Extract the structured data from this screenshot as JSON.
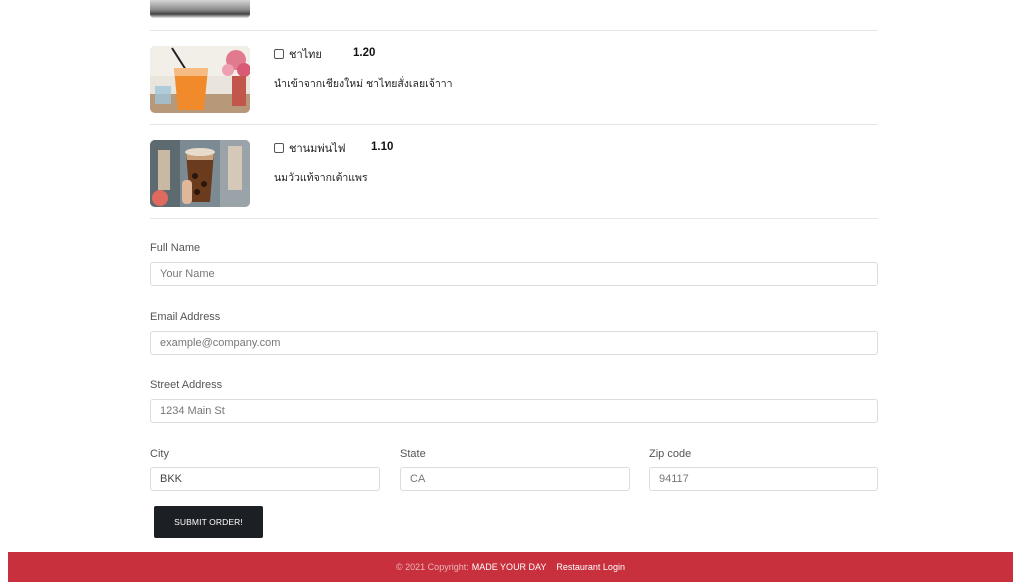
{
  "menu": {
    "items": [
      {
        "name": "ชาไทย",
        "price": "1.20",
        "description": "นำเข้าจากเชียงใหม่ ชาไทยสั่งเลยเจ้าาา",
        "image_icon": "thai-tea-photo"
      },
      {
        "name": "ชานมพ่นไฟ",
        "price": "1.10",
        "description": "นมวัวแท้จากเต้าแพร",
        "image_icon": "milk-tea-photo"
      }
    ]
  },
  "form": {
    "full_name": {
      "label": "Full Name",
      "placeholder": "Your Name"
    },
    "email": {
      "label": "Email Address",
      "placeholder": "example@company.com"
    },
    "street": {
      "label": "Street Address",
      "placeholder": "1234 Main St"
    },
    "city": {
      "label": "City",
      "value": "BKK"
    },
    "state": {
      "label": "State",
      "placeholder": "CA"
    },
    "zip": {
      "label": "Zip code",
      "placeholder": "94117"
    },
    "submit_label": "SUBMIT ORDER!"
  },
  "footer": {
    "copyright": "© 2021 Copyright:",
    "brand": "MADE YOUR DAY",
    "login_link": "Restaurant Login"
  },
  "colors": {
    "footer_bg": "#c8303d",
    "button_bg": "#1c1f24"
  }
}
